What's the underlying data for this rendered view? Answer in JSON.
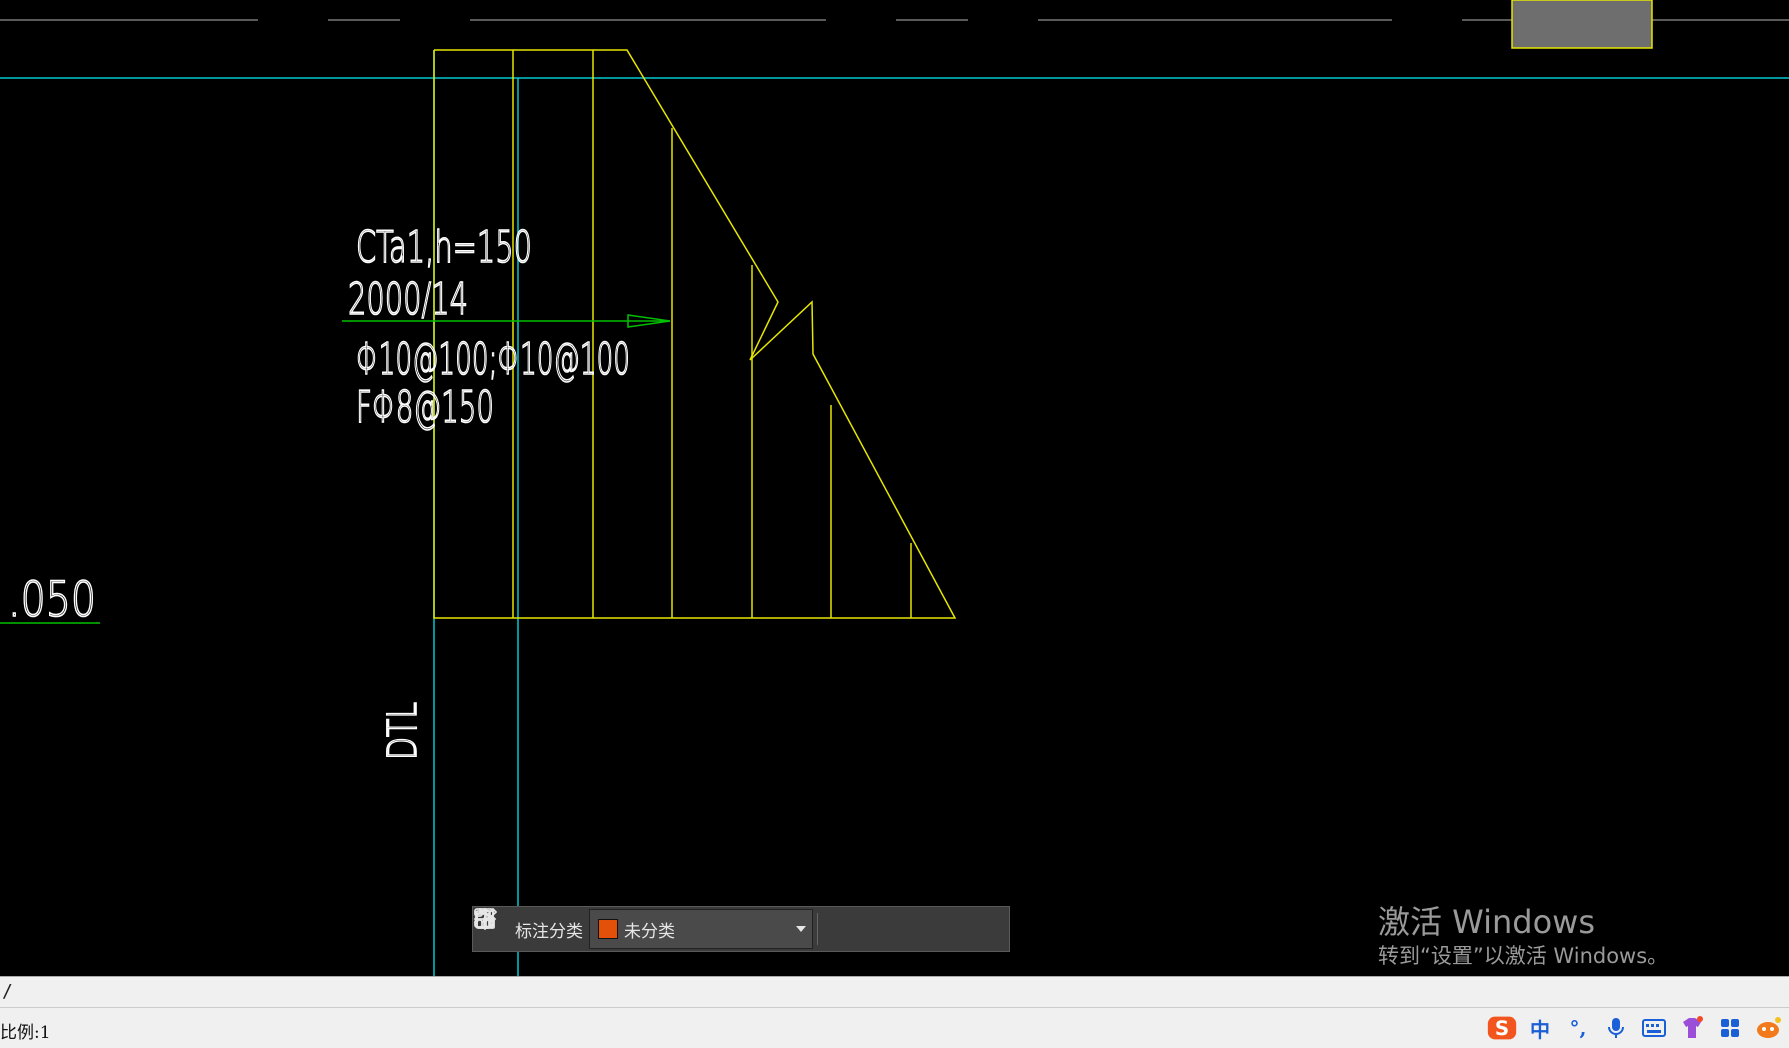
{
  "drawing": {
    "label_line1": "CTa1,h=150",
    "label_line2": "2000/14",
    "label_line3": "Φ10@100;Φ10@100",
    "label_line4": "FΦ8@150",
    "vertical_label": "DTL",
    "elevation_label": ".050"
  },
  "toolbar": {
    "category_label": "标注分类",
    "selected_category": "未分类",
    "swatch_color": "#e2500a",
    "icons": [
      "grid-icon",
      "edit-icon",
      "move-icon",
      "copy-icon",
      "paste-icon"
    ]
  },
  "watermark": {
    "title": "激活 Windows",
    "subtitle": "转到“设置”以激活 Windows。"
  },
  "command_line": {
    "text": "/"
  },
  "status": {
    "scale": "比例:1"
  },
  "ime": {
    "items": [
      "S",
      "中",
      "°,",
      "mic-icon",
      "keyboard-icon",
      "shirt-icon",
      "apps-icon",
      "mascot-icon"
    ],
    "mode_label": "中",
    "punct_label": "°,"
  },
  "colors": {
    "background": "#000000",
    "stair_lines": "#e6e600",
    "axis_lines": "#00c8d0",
    "leader_line": "#00c000",
    "text": "#ffffff"
  }
}
